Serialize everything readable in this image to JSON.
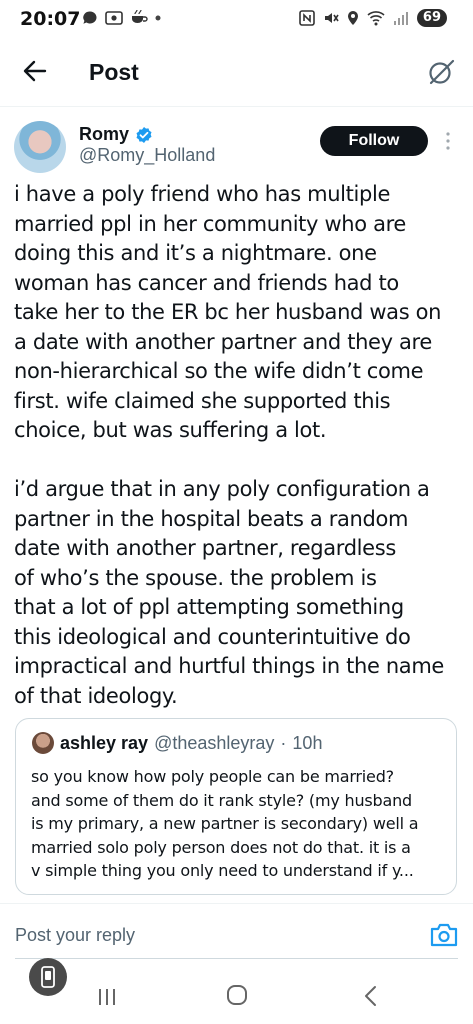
{
  "status_bar": {
    "time": "20:07",
    "battery": "69"
  },
  "header": {
    "title": "Post"
  },
  "post": {
    "author_name": "Romy",
    "author_handle": "@Romy_Holland",
    "follow_label": "Follow",
    "text": "i have a poly friend who has multiple\nmarried ppl in her community who are\ndoing this and it’s a nightmare. one\nwoman has cancer and friends had to\ntake her to the ER bc her husband was on\na date with another partner and they are\nnon-hierarchical so the wife didn’t come\nfirst. wife claimed she supported this\nchoice, but was suffering a lot.\n\ni’d argue that in any poly configuration a\npartner in the hospital beats a random\ndate with another partner, regardless\nof who’s the spouse. the problem is\nthat a lot of ppl attempting something\nthis ideological and counterintuitive do\nimpractical and hurtful things in the name\nof that ideology."
  },
  "quote": {
    "author_name": "ashley ray",
    "author_handle": "@theashleyray",
    "separator": "·",
    "time": "10h",
    "text": "so you know how poly people can be married?\nand some of them do it rank style? (my husband\nis my primary, a new partner is secondary) well a\nmarried solo poly person does not do that. it is a\nv simple thing you only need to understand if y..."
  },
  "reply": {
    "placeholder": "Post your reply"
  },
  "colors": {
    "text_primary": "#0f1419",
    "text_secondary": "#536471",
    "accent": "#1d9bf0",
    "follow_bg": "#0f1419"
  },
  "icons": {
    "back": "arrow-left-icon",
    "grok": "grok-icon",
    "verified": "verified-badge-icon",
    "more": "vertical-dots-icon",
    "camera": "camera-icon"
  }
}
